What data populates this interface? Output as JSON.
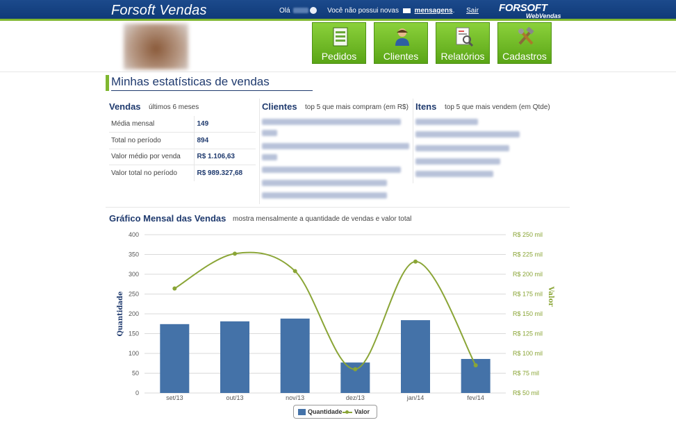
{
  "header": {
    "app_title": "Forsoft Vendas",
    "greeting_prefix": "Olá",
    "message_text": "Você não possui novas",
    "messages_link": "mensagens",
    "message_suffix": ".",
    "logout": "Sair",
    "brand": "FORSOFT",
    "brand_sub": "WebVendas"
  },
  "nav": [
    {
      "label": "Pedidos",
      "icon": "orders-sheet-icon"
    },
    {
      "label": "Clientes",
      "icon": "client-person-icon"
    },
    {
      "label": "Relatórios",
      "icon": "report-magnifier-icon"
    },
    {
      "label": "Cadastros",
      "icon": "tools-icon"
    }
  ],
  "page_title": "Minhas estatísticas de vendas",
  "vendas": {
    "title": "Vendas",
    "subtitle": "últimos 6 meses",
    "rows": [
      {
        "label": "Média mensal",
        "value": "149"
      },
      {
        "label": "Total no período",
        "value": "894"
      },
      {
        "label": "Valor médio por venda",
        "value": "R$ 1.106,63"
      },
      {
        "label": "Valor total no período",
        "value": "R$ 989.327,68"
      }
    ]
  },
  "clientes": {
    "title": "Clientes",
    "subtitle": "top 5 que mais compram (em R$)"
  },
  "itens": {
    "title": "Itens",
    "subtitle": "top 5 que mais vendem (em Qtde)"
  },
  "grafico": {
    "title": "Gráfico Mensal das Vendas",
    "subtitle": "mostra mensalmente a quantidade de vendas e valor total"
  },
  "colors": {
    "header_bg": "#1c4a8c",
    "accent_green": "#7fb72f",
    "bar": "#4472a8",
    "line": "#8aa536",
    "title_blue": "#1f3a6e"
  },
  "chart_data": {
    "type": "bar",
    "categories": [
      "set/13",
      "out/13",
      "nov/13",
      "dez/13",
      "jan/14",
      "fev/14"
    ],
    "series": [
      {
        "name": "Quantidade",
        "type": "bar",
        "axis": "left",
        "values": [
          174,
          181,
          188,
          77,
          184,
          86
        ]
      },
      {
        "name": "Valor",
        "type": "line",
        "axis": "right",
        "values": [
          182,
          226,
          204,
          80,
          216,
          85
        ]
      }
    ],
    "ylabel": "Quantidade",
    "y2label": "Valor",
    "ylim": [
      0,
      400
    ],
    "y2lim": [
      50,
      250
    ],
    "yticks": [
      "0",
      "50",
      "100",
      "150",
      "200",
      "250",
      "300",
      "350",
      "400"
    ],
    "y2ticks": [
      "R$ 50 mil",
      "R$ 75 mil",
      "R$ 100 mil",
      "R$ 125 mil",
      "R$ 150 mil",
      "R$ 175 mil",
      "R$ 200 mil",
      "R$ 225 mil",
      "R$ 250 mil"
    ],
    "grid": true,
    "legend": "bottom"
  }
}
